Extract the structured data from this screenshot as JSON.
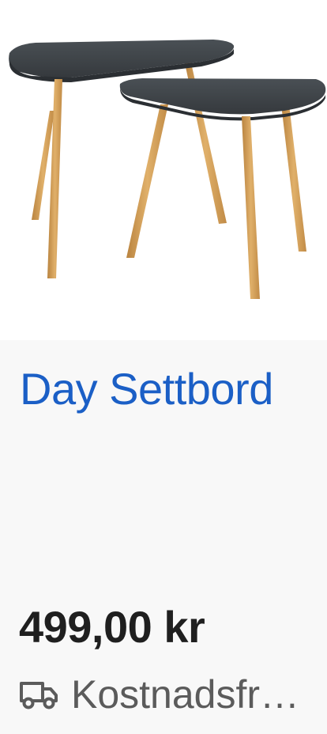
{
  "product": {
    "title": "Day Settbord",
    "price": "499,00 kr",
    "shipping": {
      "icon": "truck-icon",
      "label": "Kostnadsfr…"
    }
  },
  "colors": {
    "title": "#1b5fc6",
    "price": "#1f1f1f",
    "shipping_text": "#5b5b5b",
    "background": "#f8f8f8",
    "image_background": "#ffffff",
    "table_top": "#3f4448",
    "table_legs": "#d3a05b"
  }
}
